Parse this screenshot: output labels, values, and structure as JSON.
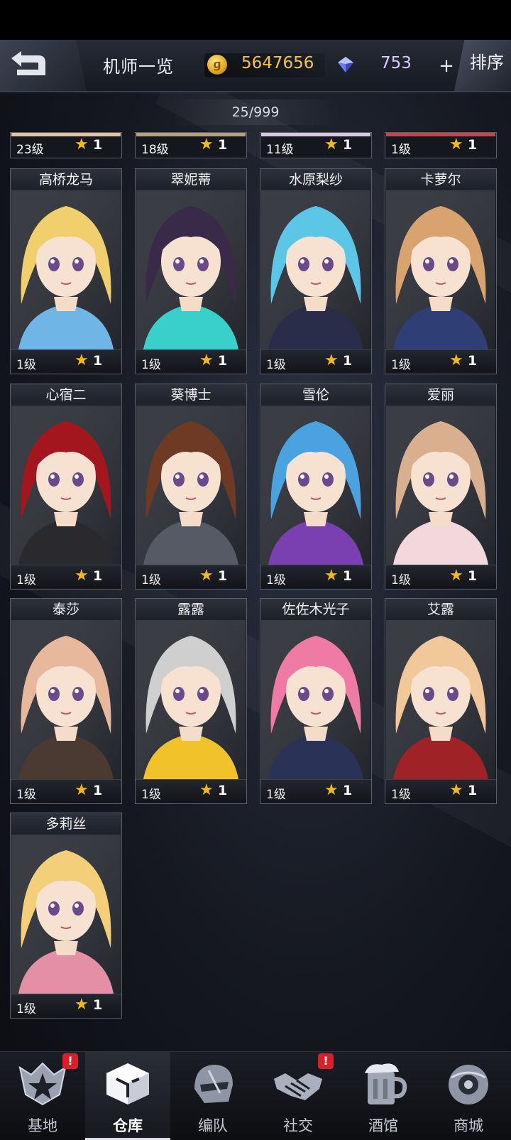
{
  "header": {
    "title": "机师一览",
    "gold_value": "5647656",
    "gem_value": "753",
    "sort_label": "排序"
  },
  "roster_count": "25/999",
  "partial_row": [
    {
      "level": "23级",
      "stars": "1"
    },
    {
      "level": "18级",
      "stars": "1"
    },
    {
      "level": "11级",
      "stars": "1"
    },
    {
      "level": "1级",
      "stars": "1"
    }
  ],
  "pilots": [
    {
      "name": "高桥龙马",
      "level": "1级",
      "stars": "1",
      "hair": "#f1cf6c",
      "accent": "#6fb6e6"
    },
    {
      "name": "翠妮蒂",
      "level": "1级",
      "stars": "1",
      "hair": "#3a2a4a",
      "accent": "#38d0c8"
    },
    {
      "name": "水原梨纱",
      "level": "1级",
      "stars": "1",
      "hair": "#5cc6e6",
      "accent": "#2a2d49"
    },
    {
      "name": "卡萝尔",
      "level": "1级",
      "stars": "1",
      "hair": "#d8a36e",
      "accent": "#2f3e74"
    },
    {
      "name": "心宿二",
      "level": "1级",
      "stars": "1",
      "hair": "#a3161e",
      "accent": "#2a2a2e"
    },
    {
      "name": "葵博士",
      "level": "1级",
      "stars": "1",
      "hair": "#6e3a24",
      "accent": "#555a64"
    },
    {
      "name": "雪伦",
      "level": "1级",
      "stars": "1",
      "hair": "#4aa2e0",
      "accent": "#7a3fb0"
    },
    {
      "name": "爱丽",
      "level": "1级",
      "stars": "1",
      "hair": "#d9b08f",
      "accent": "#f2d7dc"
    },
    {
      "name": "泰莎",
      "level": "1级",
      "stars": "1",
      "hair": "#e8b89c",
      "accent": "#4a3a32"
    },
    {
      "name": "露露",
      "level": "1级",
      "stars": "1",
      "hair": "#cfcfcf",
      "accent": "#f2c22a"
    },
    {
      "name": "佐佐木光子",
      "level": "1级",
      "stars": "1",
      "hair": "#ef7aa3",
      "accent": "#2b3258"
    },
    {
      "name": "艾露",
      "level": "1级",
      "stars": "1",
      "hair": "#f0c89a",
      "accent": "#9e2226"
    },
    {
      "name": "多莉丝",
      "level": "1级",
      "stars": "1",
      "hair": "#f2cf78",
      "accent": "#e58fa6"
    }
  ],
  "nav": [
    {
      "label": "基地",
      "icon": "base-emblem-icon",
      "alert": true
    },
    {
      "label": "仓库",
      "icon": "warehouse-cube-icon",
      "alert": false,
      "active": true
    },
    {
      "label": "编队",
      "icon": "mech-helmet-icon",
      "alert": false
    },
    {
      "label": "社交",
      "icon": "handshake-icon",
      "alert": true
    },
    {
      "label": "酒馆",
      "icon": "beer-mug-icon",
      "alert": false
    },
    {
      "label": "商城",
      "icon": "shop-sphere-icon",
      "alert": false
    }
  ],
  "colors": {
    "gold": "#f2c446",
    "gem": "#d8c8ff",
    "star": "#f3b81c",
    "alert": "#d81f2b"
  }
}
